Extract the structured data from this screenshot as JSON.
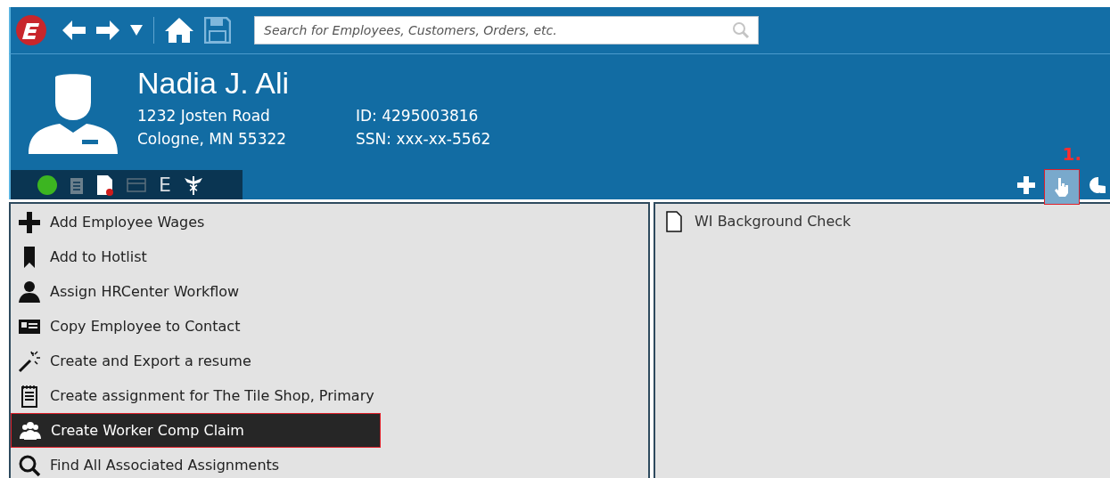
{
  "toolbar": {
    "search": {
      "placeholder": "Search for Employees, Customers, Orders, etc."
    }
  },
  "profile": {
    "name": "Nadia J. Ali",
    "address_line_1": "1232 Josten Road",
    "address_line_2": "Cologne, MN 55322",
    "id": "ID: 4295003816",
    "ssn": "SSN: xxx-xx-5562"
  },
  "status_icons": [
    {
      "kind": "status-dot",
      "color": "#3cb521"
    },
    {
      "kind": "clipboard"
    },
    {
      "kind": "document-badge"
    },
    {
      "kind": "card"
    },
    {
      "kind": "letter",
      "text": "E"
    },
    {
      "kind": "caduceus"
    }
  ],
  "annotation": {
    "label": "1."
  },
  "actions": [
    {
      "kind": "add",
      "selected": false
    },
    {
      "kind": "pointer",
      "selected": true
    },
    {
      "kind": "chart",
      "selected": false
    }
  ],
  "menu_items": [
    {
      "kind": "plus",
      "label": "Add Employee Wages",
      "selected": false
    },
    {
      "kind": "bookmark",
      "label": "Add to Hotlist",
      "selected": false
    },
    {
      "kind": "person",
      "label": "Assign HRCenter Workflow",
      "selected": false
    },
    {
      "kind": "contact-card",
      "label": "Copy Employee to Contact",
      "selected": false
    },
    {
      "kind": "wand",
      "label": "Create and Export a resume",
      "selected": false
    },
    {
      "kind": "notepad",
      "label": "Create assignment for The Tile Shop, Primary",
      "selected": false
    },
    {
      "kind": "group",
      "label": "Create Worker Comp Claim",
      "selected": true
    },
    {
      "kind": "search",
      "label": "Find All Associated Assignments",
      "selected": false
    }
  ],
  "documents": [
    {
      "label": "WI Background Check"
    }
  ]
}
